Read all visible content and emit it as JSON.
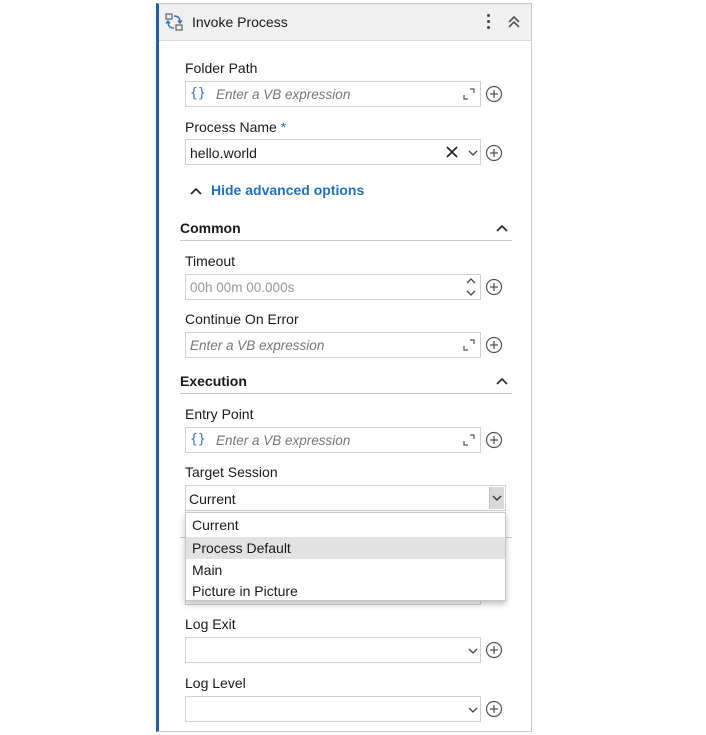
{
  "header": {
    "title": "Invoke Process",
    "icon": "invoke-process-icon"
  },
  "folder_path": {
    "label": "Folder Path",
    "placeholder": "Enter a VB expression"
  },
  "process_name": {
    "label": "Process Name",
    "required_mark": "*",
    "value": "hello.world"
  },
  "advanced_toggle": {
    "label": "Hide advanced options"
  },
  "common": {
    "title": "Common",
    "timeout": {
      "label": "Timeout",
      "placeholder": "00h 00m 00.000s"
    },
    "continue_on_error": {
      "label": "Continue On Error",
      "placeholder": "Enter a VB expression"
    }
  },
  "execution": {
    "title": "Execution",
    "entry_point": {
      "label": "Entry Point",
      "placeholder": "Enter a VB expression"
    },
    "target_session": {
      "label": "Target Session",
      "value": "Current",
      "options": [
        "Current",
        "Process Default",
        "Main",
        "Picture in Picture"
      ],
      "highlighted_option": "Process Default"
    }
  },
  "log_exit": {
    "label": "Log Exit",
    "value": ""
  },
  "log_level": {
    "label": "Log Level",
    "value": ""
  },
  "colors": {
    "accent": "#1f6fc1",
    "panel_border": "#1f5fa8",
    "header_bg": "#f0f0f0"
  }
}
